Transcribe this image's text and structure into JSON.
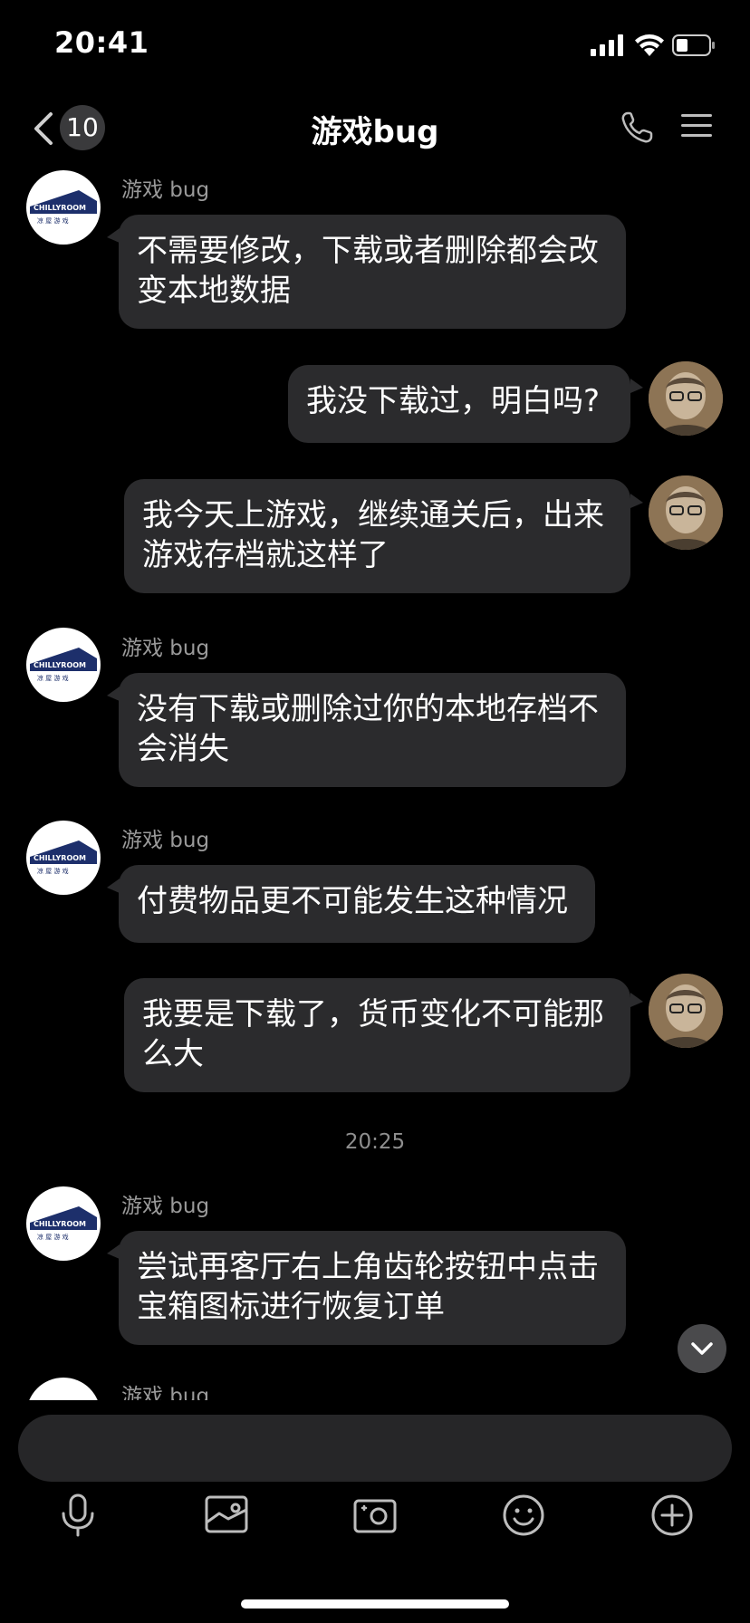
{
  "status_bar": {
    "time": "20:41"
  },
  "header": {
    "title": "游戏bug",
    "unread_count": "10"
  },
  "messages": [
    {
      "from": "them",
      "sender": "游戏 bug",
      "lines": [
        "不需要修改，下载或者删除都会改",
        "变本地数据"
      ]
    },
    {
      "from": "me",
      "lines": [
        "我没下载过，明白吗?"
      ]
    },
    {
      "from": "me",
      "lines": [
        "我今天上游戏，继续通关后，出来",
        "游戏存档就这样了"
      ]
    },
    {
      "from": "them",
      "sender": "游戏 bug",
      "lines": [
        "没有下载或删除过你的本地存档不",
        "会消失"
      ]
    },
    {
      "from": "them",
      "sender": "游戏 bug",
      "lines": [
        "付费物品更不可能发生这种情况"
      ]
    },
    {
      "from": "me",
      "lines": [
        "我要是下载了，货币变化不可能那",
        "么大"
      ]
    },
    {
      "from": "them",
      "sender": "游戏 bug",
      "lines": [
        "尝试再客厅右上角齿轮按钮中点击",
        "宝箱图标进行恢复订单"
      ]
    },
    {
      "from": "them",
      "sender": "游戏 bug",
      "lines": []
    }
  ],
  "timestamp": "20:25",
  "logo_text": {
    "top": "CHILLYROOM",
    "bottom": "凉 屋 游 戏"
  },
  "toolbar": [
    "microphone-icon",
    "image-icon",
    "camera-icon",
    "emoji-icon",
    "plus-icon"
  ],
  "colors": {
    "bubble": "#2b2b2d",
    "background": "#000000",
    "meta_text": "#9a9a9a"
  }
}
